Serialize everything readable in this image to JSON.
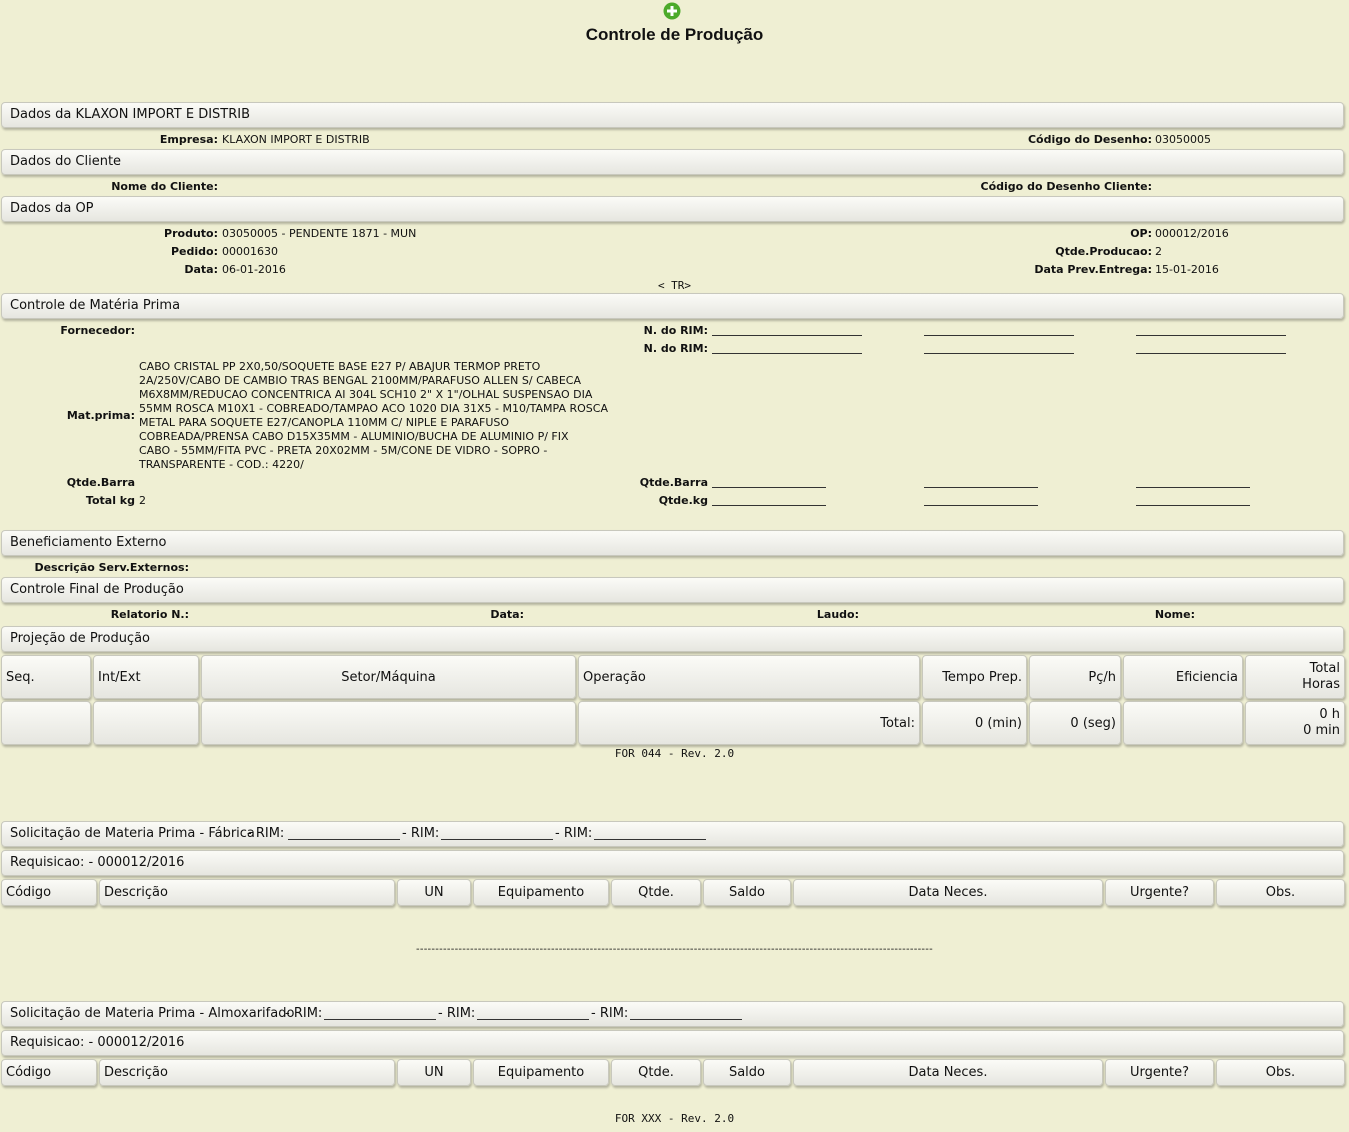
{
  "page_title": "Controle de Produção",
  "icons": {
    "add": "plus-circle-icon",
    "add_color": "#4caa2a"
  },
  "colors": {
    "background": "#efefd3"
  },
  "empresa": {
    "section": "Dados da KLAXON IMPORT E DISTRIB",
    "empresa_label": "Empresa:",
    "empresa_value": "KLAXON IMPORT E DISTRIB",
    "codigo_label": "Código do Desenho:",
    "codigo_value": "03050005"
  },
  "cliente": {
    "section": "Dados do Cliente",
    "nome_label": "Nome do Cliente:",
    "codigo_label": "Código do Desenho Cliente:"
  },
  "op": {
    "section": "Dados da OP",
    "produto_label": "Produto:",
    "produto_value": "03050005 - PENDENTE 1871 - MUN",
    "pedido_label": "Pedido:",
    "pedido_value": "00001630",
    "data_label": "Data:",
    "data_value": "06-01-2016",
    "op_label": "OP:",
    "op_value": "000012/2016",
    "qtde_label": "Qtde.Producao:",
    "qtde_value": "2",
    "entrega_label": "Data Prev.Entrega:",
    "entrega_value": "15-01-2016",
    "tr": "< TR>"
  },
  "materia": {
    "section": "Controle de Matéria Prima",
    "fornecedor_label": "Fornecedor:",
    "rim_label": "N. do RIM:",
    "mat_label": "Mat.prima:",
    "mat_lines": [
      "CABO CRISTAL PP 2X0,50/SOQUETE BASE E27 P/ ABAJUR TERMOP PRETO",
      "2A/250V/CABO DE CAMBIO TRAS BENGAL 2100MM/PARAFUSO ALLEN S/ CABECA",
      "M6X8MM/REDUCAO CONCENTRICA AI 304L SCH10 2\" X 1\"/OLHAL SUSPENSAO DIA",
      "55MM ROSCA M10X1 - COBREADO/TAMPAO ACO 1020 DIA 31X5 - M10/TAMPA ROSCA",
      "METAL PARA SOQUETE E27/CANOPLA 110MM C/ NIPLE E PARAFUSO",
      "COBREADA/PRENSA CABO D15X35MM - ALUMINIO/BUCHA DE ALUMINIO P/ FIX",
      "CABO - 55MM/FITA PVC - PRETA 20X02MM - 5M/CONE DE VIDRO - SOPRO -",
      "TRANSPARENTE - COD.: 4220/"
    ],
    "qtde_barra_label": "Qtde.Barra",
    "total_kg_label": "Total kg",
    "total_kg_value": "2",
    "qtde_kg_label": "Qtde.kg"
  },
  "beneficiamento": {
    "section": "Beneficiamento Externo",
    "descricao_label": "Descrição Serv.Externos:"
  },
  "controle_final": {
    "section": "Controle Final de Produção",
    "relatorio_label": "Relatorio N.:",
    "data_label": "Data:",
    "laudo_label": "Laudo:",
    "nome_label": "Nome:"
  },
  "projecao": {
    "section": "Projeção de Produção",
    "headers": {
      "seq": "Seq.",
      "int_ext": "Int/Ext",
      "setor": "Setor/Máquina",
      "operacao": "Operação",
      "tempo": "Tempo Prep.",
      "pch": "Pç/h",
      "eficiencia": "Eficiencia",
      "total_horas_1": "Total",
      "total_horas_2": "Horas"
    },
    "total_label": "Total:",
    "total_tempo": "0 (min)",
    "total_pch": "0 (seg)",
    "total_horas_h": "0 h",
    "total_horas_min": "0 min",
    "footer": "FOR 044 - Rev. 2.0"
  },
  "fabrica": {
    "section": "Solicitação de Materia Prima - Fábrica",
    "rim_label": "- RIM:",
    "requisicao": "Requisicao: - 000012/2016"
  },
  "almox": {
    "section": "Solicitação de Materia Prima - Almoxarifado",
    "rim_label": "- RIM:",
    "requisicao": "Requisicao: - 000012/2016"
  },
  "req_headers": {
    "codigo": "Código",
    "descricao": "Descrição",
    "un": "UN",
    "equipamento": "Equipamento",
    "qtde": "Qtde.",
    "saldo": "Saldo",
    "data": "Data Neces.",
    "urgente": "Urgente?",
    "obs": "Obs."
  },
  "separator": "--------------------------------------------------------------------------------------------------------------------------------------",
  "footer_xxx": "FOR XXX - Rev. 2.0"
}
